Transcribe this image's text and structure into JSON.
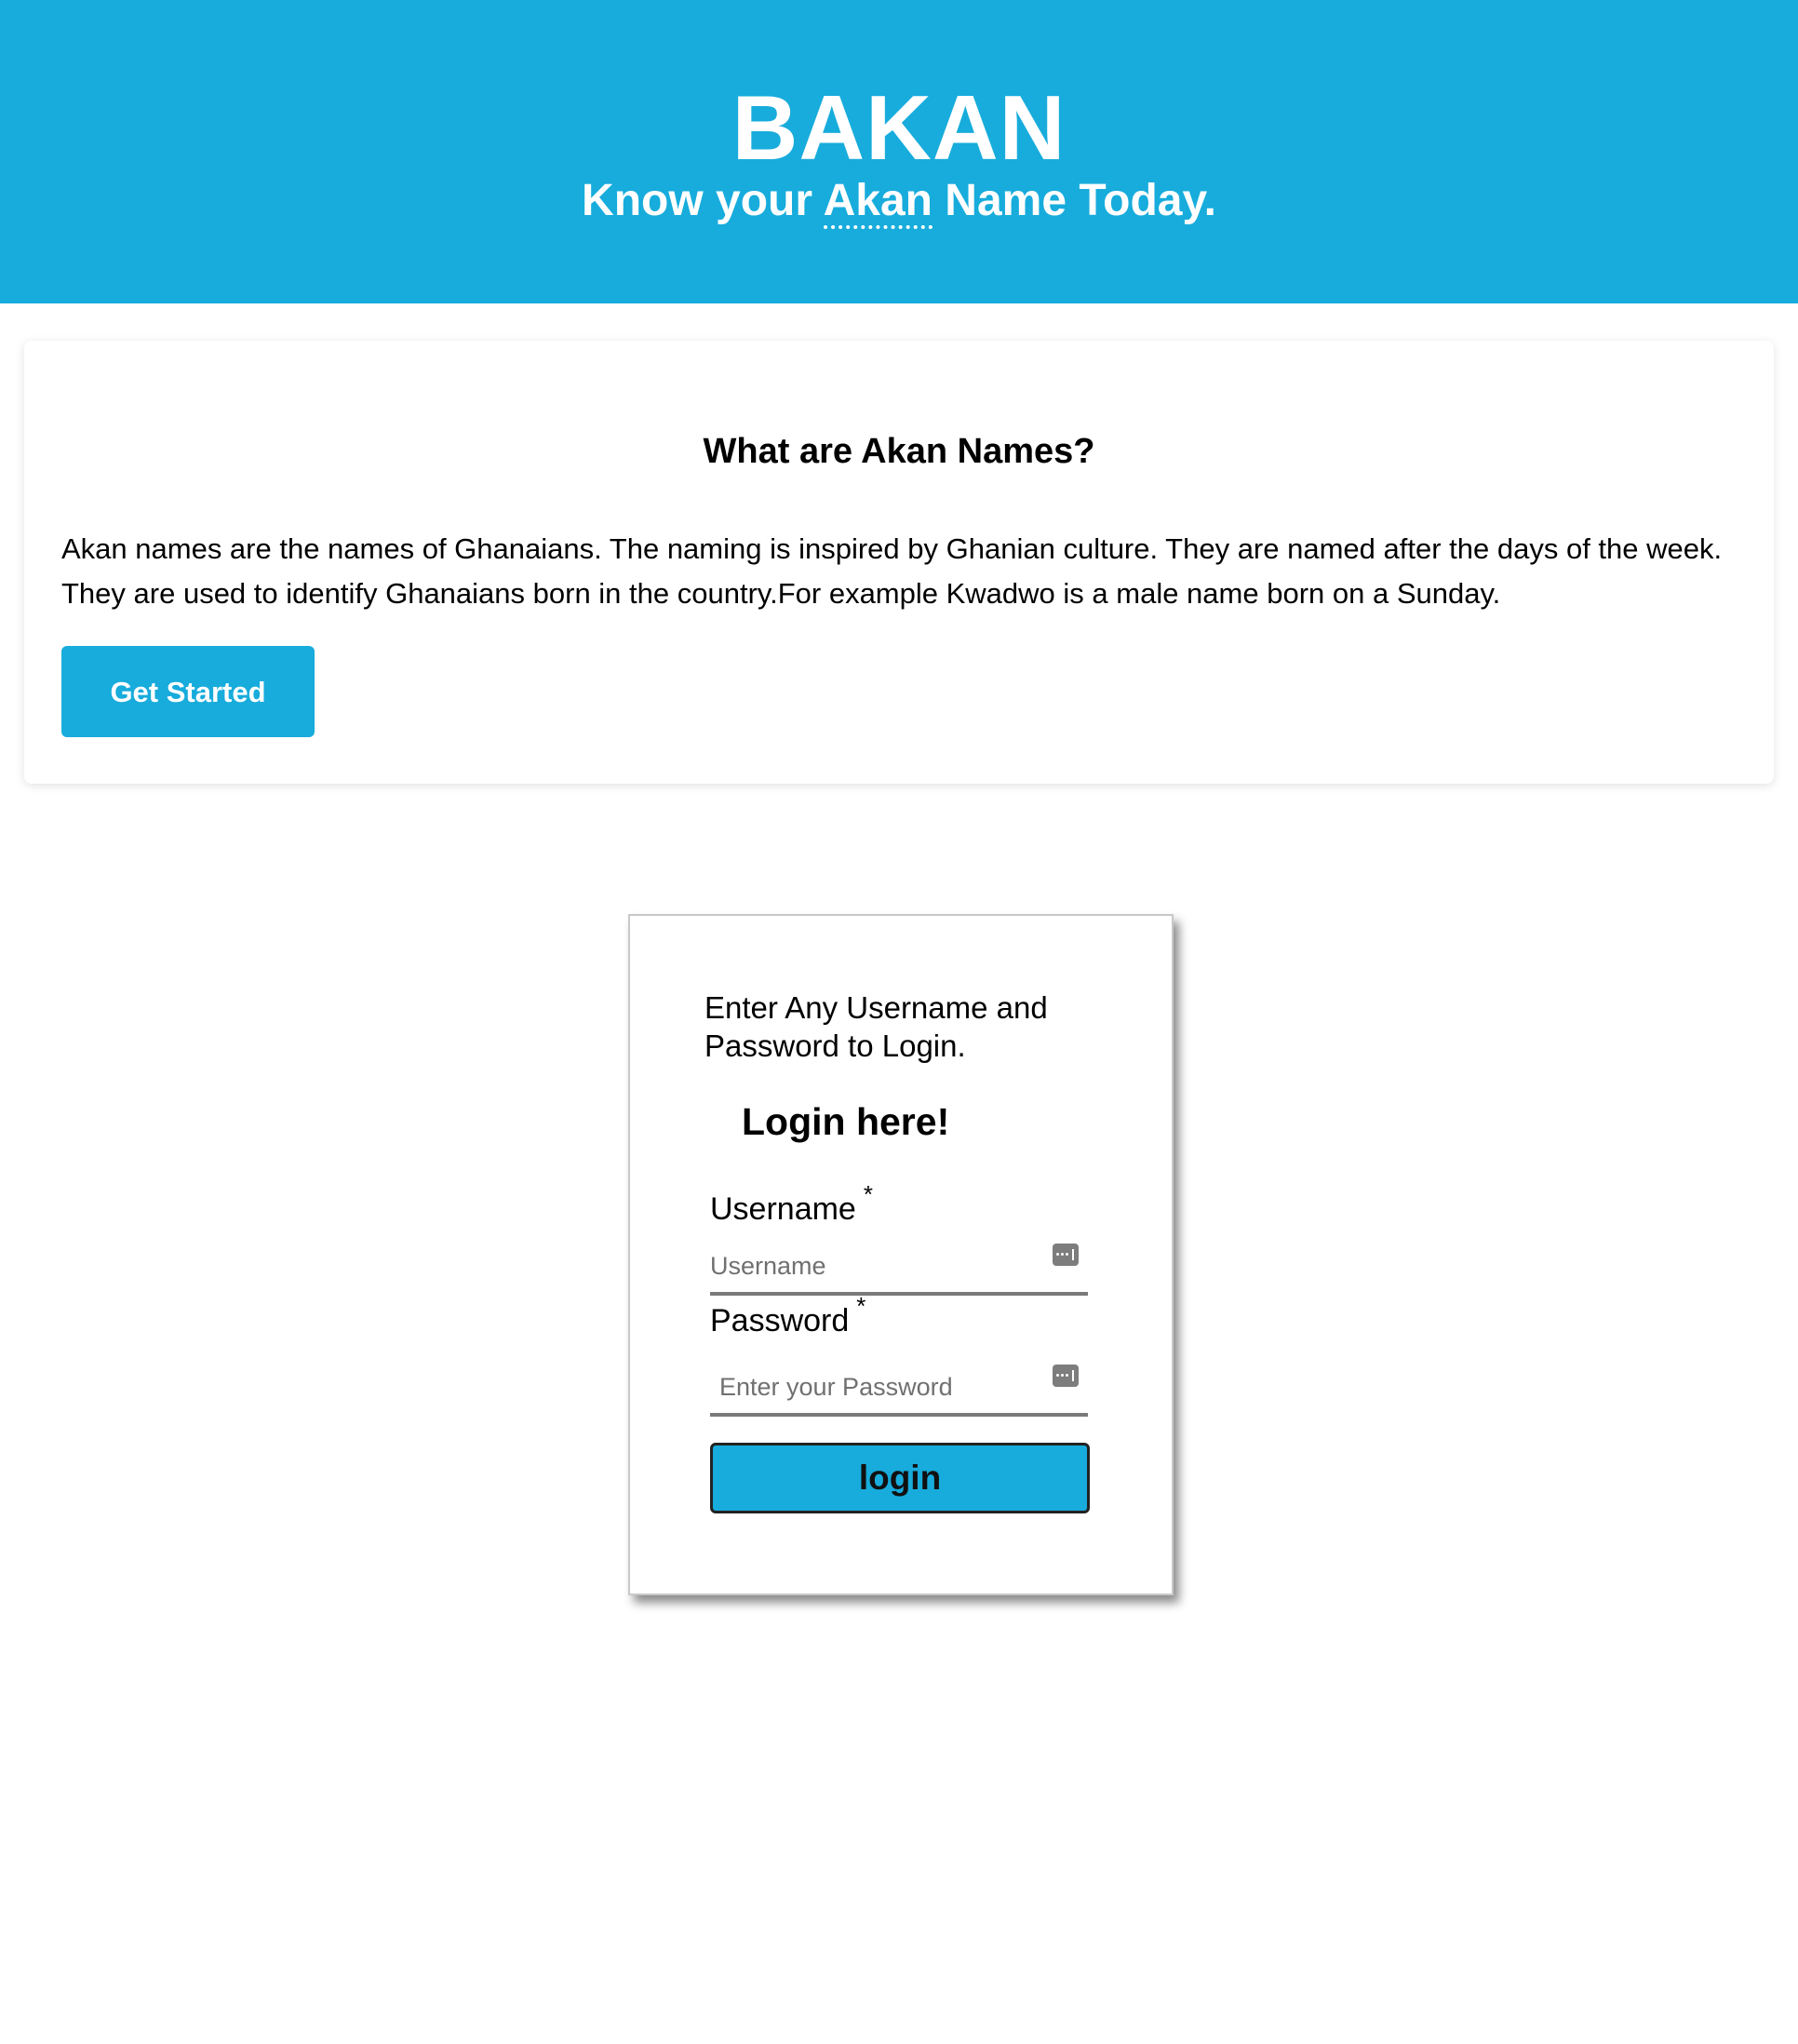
{
  "header": {
    "brand": "BAKAN",
    "tagline_before": "Know your ",
    "tagline_abbr": "Akan",
    "tagline_after": " Name Today.",
    "background_color": "#17acdc"
  },
  "info": {
    "title": "What are Akan Names?",
    "text": "Akan names are the names of Ghanaians. The naming is inspired by Ghanian culture. They are named after the days of the week. They are used to identify Ghanaians born in the country.For example Kwadwo is a male name born on a Sunday.",
    "button_label": "Get Started"
  },
  "login": {
    "note": "Enter Any Username and Password to Login.",
    "heading": "Login here!",
    "username_label": "Username",
    "username_required": "*",
    "username_placeholder": "Username",
    "username_value": "",
    "username_icon": "password-manager-key-icon",
    "password_label": "Password",
    "password_required": "*",
    "password_placeholder": "Enter your Password",
    "password_value": "",
    "password_icon": "password-manager-key-icon",
    "button_label": "login"
  }
}
